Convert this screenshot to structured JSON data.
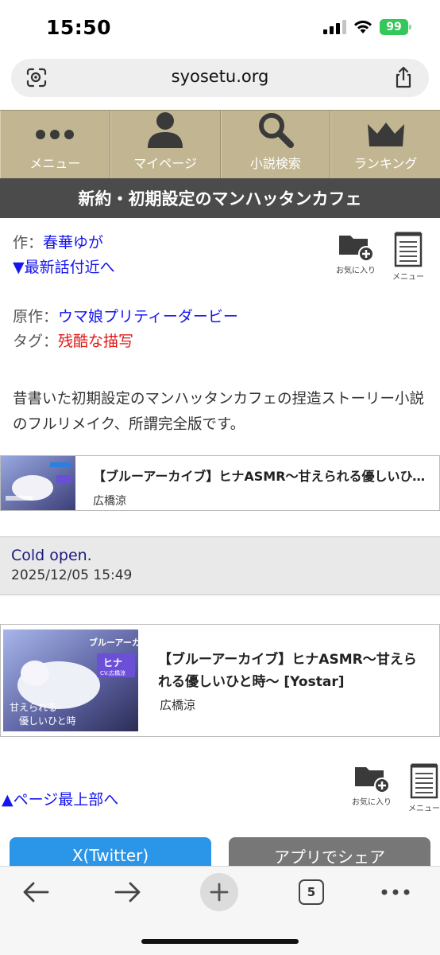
{
  "status": {
    "time": "15:50",
    "battery": "99"
  },
  "browser": {
    "url": "syosetu.org",
    "tab_count": "5"
  },
  "nav": [
    {
      "label": "メニュー",
      "icon": "dots-icon"
    },
    {
      "label": "マイページ",
      "icon": "person-icon"
    },
    {
      "label": "小説検索",
      "icon": "magnifier-icon"
    },
    {
      "label": "ランキング",
      "icon": "crown-icon"
    }
  ],
  "novel": {
    "title": "新約・初期設定のマンハッタンカフェ",
    "author_prefix": "作：",
    "author": "春華ゆが",
    "latest_link": "▼最新話付近へ",
    "original_prefix": "原作：",
    "original": "ウマ娘プリティーダービー",
    "tag_prefix": "タグ：",
    "tag": "残酷な描写",
    "description": "昔書いた初期設定のマンハッタンカフェの捏造ストーリー小説のフルリメイク、所謂完全版です。"
  },
  "actions": {
    "favorite": "お気に入り",
    "menu": "メニュー"
  },
  "ad1": {
    "title": "【ブルーアーカイブ】ヒナASMR～甘えられる優しいひと時～ [Yostar]",
    "author": "広橋涼"
  },
  "chapter": {
    "title": "Cold open.",
    "date": "2025/12/05 15:49"
  },
  "ad2": {
    "title": "【ブルーアーカイブ】ヒナASMR～甘えられる優しいひと時～ [Yostar]",
    "author": "広橋涼",
    "thumb_logo": "ブルーアーカイブ",
    "thumb_name": "ヒナ",
    "thumb_cv": "CV.広橋涼",
    "thumb_caption1": "甘えられる",
    "thumb_caption2": "優しいひと時"
  },
  "to_top": "▲ページ最上部へ",
  "share": {
    "twitter": "X(Twitter)",
    "app": "アプリでシェア"
  },
  "colors": {
    "nav_bg": "#c2b692",
    "title_bg": "#4b4b4b",
    "link": "#1515ee",
    "tag": "#e21616",
    "twitter": "#2b95e8"
  }
}
